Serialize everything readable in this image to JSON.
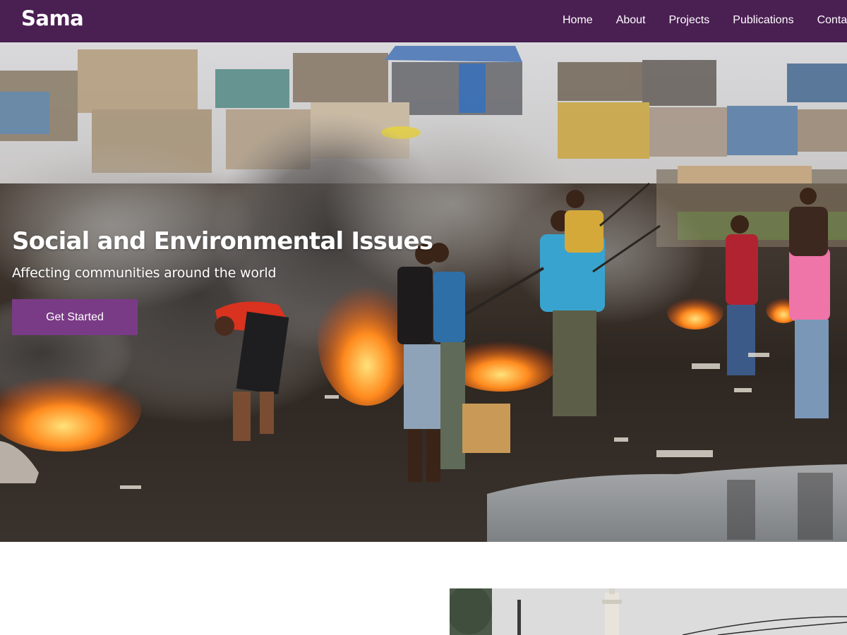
{
  "brand": {
    "name": "Sama"
  },
  "nav": {
    "items": [
      {
        "label": "Home"
      },
      {
        "label": "About"
      },
      {
        "label": "Projects"
      },
      {
        "label": "Publications"
      },
      {
        "label": "Contact"
      }
    ]
  },
  "hero": {
    "title": "Social and Environmental Issues",
    "subtitle": "Affecting communities around the world",
    "cta_label": "Get Started",
    "image_subject": "people burning waste at an e-waste dump site beside a shanty town"
  },
  "next_section": {
    "image_subject": "street scene with a minaret and power lines"
  },
  "colors": {
    "navbar": "#4a1f52",
    "cta": "#7a3b86",
    "text": "#ffffff"
  }
}
